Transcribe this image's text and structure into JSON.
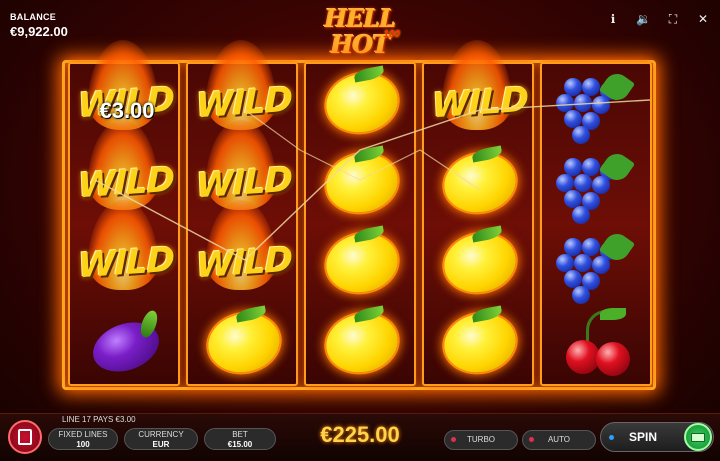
{
  "header": {
    "balance_label": "BALANCE",
    "balance_value": "€9,922.00",
    "logo_main": "HELL HOT",
    "logo_sub": "100",
    "icons": [
      "info-icon",
      "sound-icon",
      "fullscreen-icon",
      "close-icon"
    ]
  },
  "reels": [
    [
      "wild",
      "wild",
      "wild",
      "plum"
    ],
    [
      "wild",
      "wild",
      "wild",
      "lemon"
    ],
    [
      "lemon",
      "lemon",
      "lemon",
      "lemon"
    ],
    [
      "wild",
      "lemon",
      "lemon",
      "lemon"
    ],
    [
      "grapes",
      "grapes",
      "grapes",
      "cherries"
    ]
  ],
  "symbols": {
    "wild_text": "WILD"
  },
  "win": {
    "amount_label": "€3.00",
    "line_text": "LINE 17 PAYS €3.00",
    "total": "€225.00"
  },
  "controls": {
    "fixed_lines_label": "FIXED LINES",
    "fixed_lines_value": "100",
    "currency_label": "CURRENCY",
    "currency_value": "EUR",
    "bet_label": "BET",
    "bet_value": "€15.00",
    "turbo_label": "TURBO",
    "auto_label": "AUTO",
    "spin_label": "SPIN"
  },
  "colors": {
    "accent": "#ffb020",
    "win_gold": "#ffd34a",
    "spin_green": "#3ad060"
  }
}
